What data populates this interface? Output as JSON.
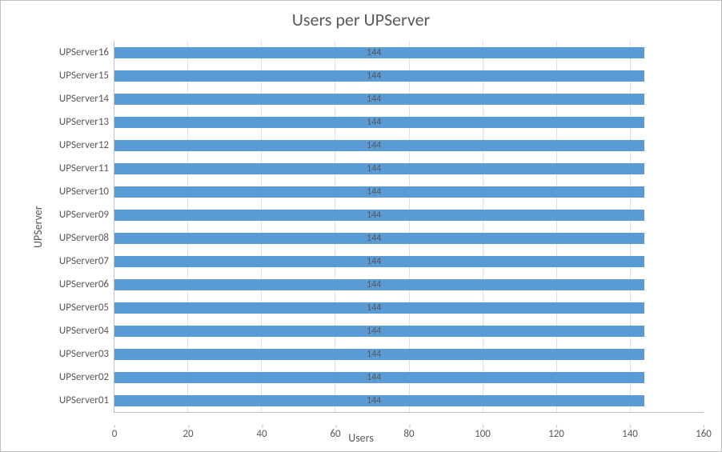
{
  "chart_data": {
    "type": "bar",
    "orientation": "horizontal",
    "title": "Users per UPServer",
    "xlabel": "Users",
    "ylabel": "UPServer",
    "xlim": [
      0,
      160
    ],
    "xticks": [
      0,
      20,
      40,
      60,
      80,
      100,
      120,
      140,
      160
    ],
    "categories": [
      "UPServer01",
      "UPServer02",
      "UPServer03",
      "UPServer04",
      "UPServer05",
      "UPServer06",
      "UPServer07",
      "UPServer08",
      "UPServer09",
      "UPServer10",
      "UPServer11",
      "UPServer12",
      "UPServer13",
      "UPServer14",
      "UPServer15",
      "UPServer16"
    ],
    "values": [
      144,
      144,
      144,
      144,
      144,
      144,
      144,
      144,
      144,
      144,
      144,
      144,
      144,
      144,
      144,
      144
    ],
    "bar_color": "#5b9bd5"
  }
}
